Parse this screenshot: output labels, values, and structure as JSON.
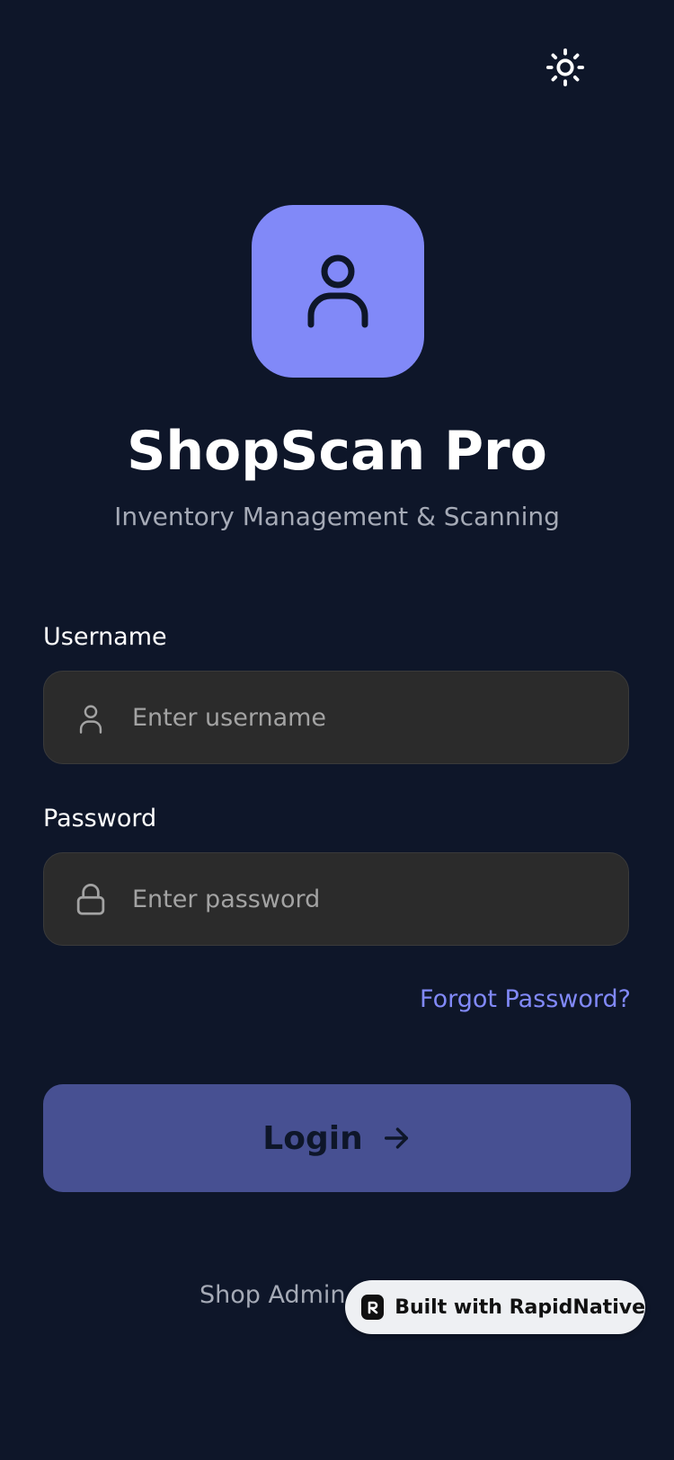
{
  "header": {
    "theme_toggle_icon": "sun-icon"
  },
  "brand": {
    "logo_icon": "user-icon",
    "logo_color": "#8189f8",
    "title": "ShopScan Pro",
    "subtitle": "Inventory Management & Scanning"
  },
  "form": {
    "username": {
      "label": "Username",
      "placeholder": "Enter username",
      "value": "",
      "icon": "user-icon"
    },
    "password": {
      "label": "Password",
      "placeholder": "Enter password",
      "value": "",
      "icon": "lock-icon"
    },
    "forgot_label": "Forgot Password?",
    "login_label": "Login",
    "login_icon": "arrow-right-icon"
  },
  "footer": {
    "text": "Shop Admin",
    "badge_label": "Built with RapidNative",
    "badge_icon": "rapidnative-logo-icon"
  },
  "colors": {
    "background": "#0e1629",
    "accent": "#8189f8",
    "button": "#475092",
    "input_bg": "#2b2b2b"
  }
}
